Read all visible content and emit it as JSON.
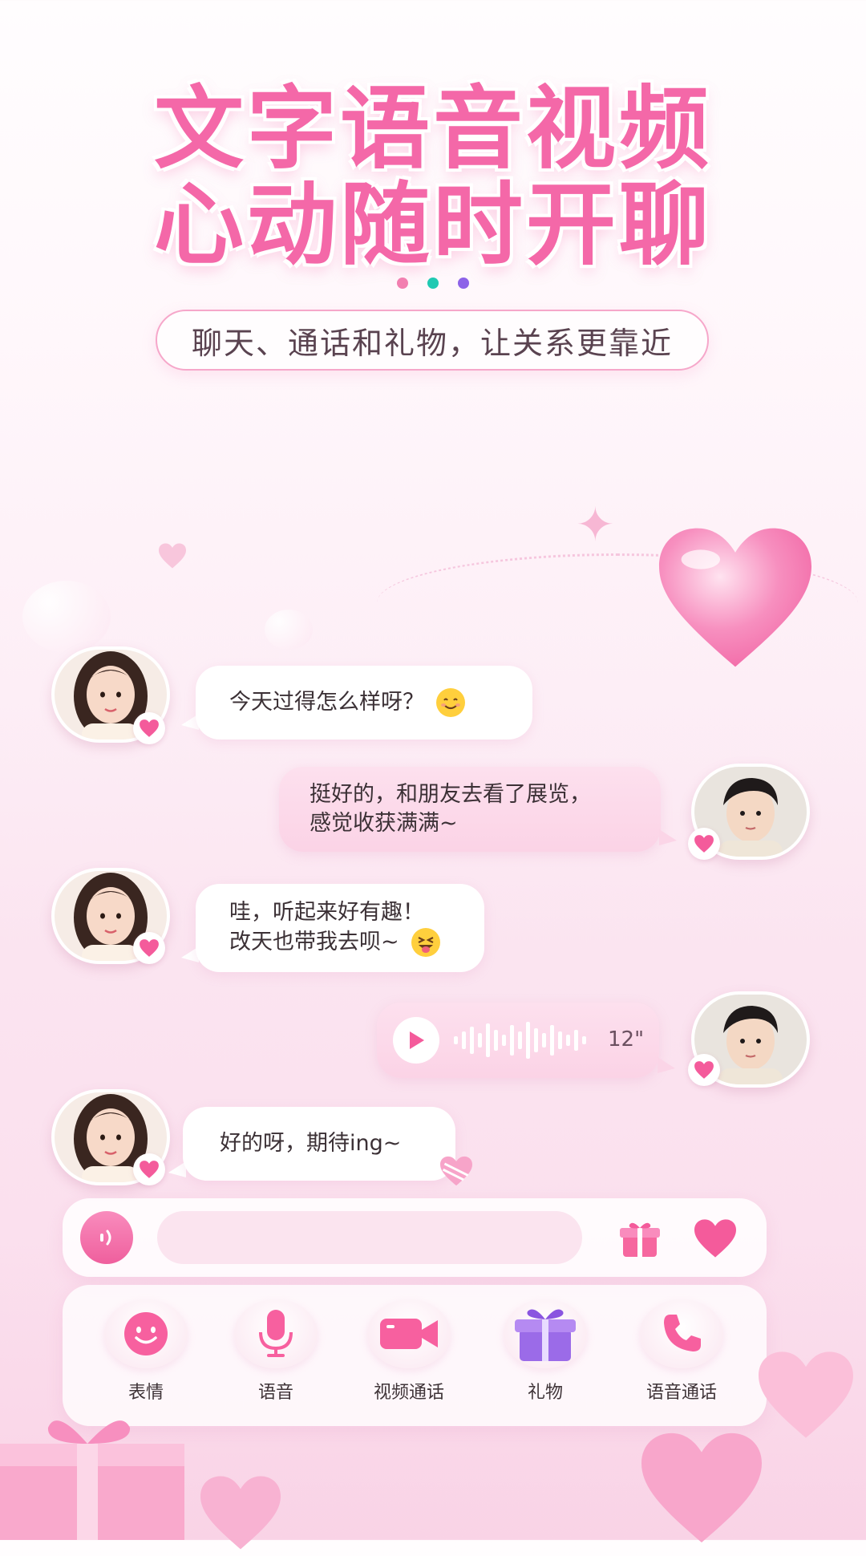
{
  "headline": {
    "line1": "文字语音视频",
    "line2": "心动随时开聊"
  },
  "subtitle": "聊天、通话和礼物，让关系更靠近",
  "dot_colors": [
    "#f27fb0",
    "#20c9b2",
    "#8d63e8"
  ],
  "chat": {
    "messages": [
      {
        "side": "left",
        "text": "今天过得怎么样呀？",
        "emoji": "smiling-face"
      },
      {
        "side": "right",
        "line1": "挺好的，和朋友去看了展览，",
        "line2": "感觉收获满满~"
      },
      {
        "side": "left",
        "line1": "哇，听起来好有趣！",
        "line2": "改天也带我去呗~",
        "emoji": "squinting-tongue-face"
      },
      {
        "side": "right",
        "type": "voice",
        "duration": "12\""
      },
      {
        "side": "left",
        "text": "好的呀，期待ing~"
      }
    ]
  },
  "input_bar": {
    "placeholder": "",
    "icons": [
      "voice-wave-icon",
      "gift-icon",
      "heart-icon"
    ]
  },
  "toolbar": {
    "items": [
      {
        "label": "表情",
        "icon": "smiley-icon"
      },
      {
        "label": "语音",
        "icon": "microphone-icon"
      },
      {
        "label": "视频通话",
        "icon": "video-camera-icon"
      },
      {
        "label": "礼物",
        "icon": "gift-box-icon"
      },
      {
        "label": "语音通话",
        "icon": "phone-icon"
      }
    ]
  },
  "colors": {
    "accent_pink": "#f468a8",
    "bubble_right": "#fbd3e6",
    "gift_purple": "#9b6be8"
  }
}
